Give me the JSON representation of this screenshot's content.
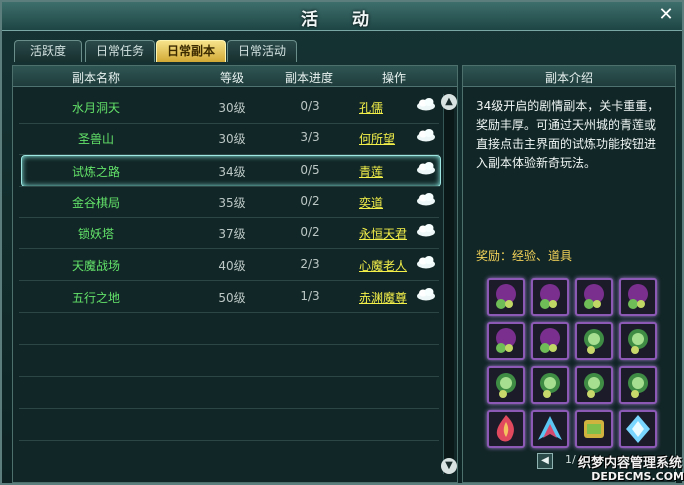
{
  "window": {
    "title": "活 动",
    "close_icon": "close-icon"
  },
  "tabs": [
    {
      "label": "活跃度"
    },
    {
      "label": "日常任务"
    },
    {
      "label": "日常副本",
      "active": true
    },
    {
      "label": "日常活动"
    }
  ],
  "table": {
    "headers": [
      "副本名称",
      "等级",
      "副本进度",
      "操作"
    ],
    "rows": [
      {
        "name": "水月洞天",
        "level": "30级",
        "progress": "0/3",
        "operator": "孔儒"
      },
      {
        "name": "圣兽山",
        "level": "30级",
        "progress": "3/3",
        "operator": "何所望"
      },
      {
        "name": "试炼之路",
        "level": "34级",
        "progress": "0/5",
        "operator": "青莲",
        "selected": true
      },
      {
        "name": "金谷棋局",
        "level": "35级",
        "progress": "0/2",
        "operator": "奕道"
      },
      {
        "name": "锁妖塔",
        "level": "37级",
        "progress": "0/2",
        "operator": "永恒天君"
      },
      {
        "name": "天魔战场",
        "level": "40级",
        "progress": "2/3",
        "operator": "心魔老人"
      },
      {
        "name": "五行之地",
        "level": "50级",
        "progress": "1/3",
        "operator": "赤渊魔尊"
      }
    ]
  },
  "intro": {
    "title": "副本介绍",
    "description": "34级开启的剧情副本，关卡重重，奖励丰厚。可通过天州城的青莲或直接点击主界面的试炼功能按钮进入副本体验新奇玩法。",
    "reward_label": "奖励：经验、道具"
  },
  "pagination": {
    "page_text": "1/"
  },
  "watermark": {
    "line1": "织梦内容管理系统",
    "line2": "DEDECMS.COM"
  },
  "colors": {
    "accent": "#f5d45a",
    "name_green": "#63e26a",
    "operator_yellow": "#f4f04a"
  }
}
